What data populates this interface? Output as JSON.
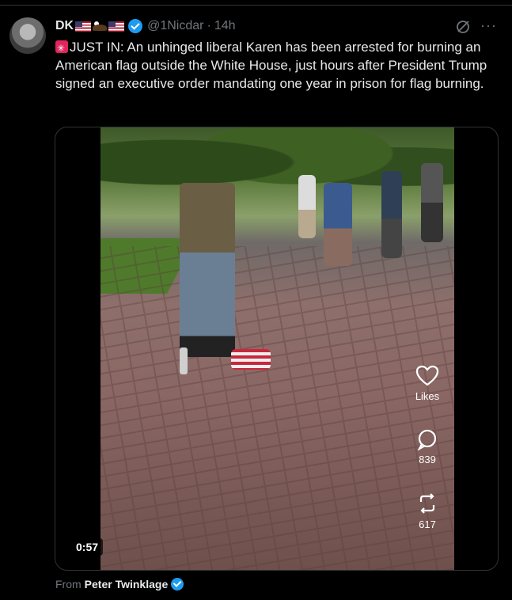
{
  "tweet": {
    "display_name": "DK",
    "handle": "@1Nicdar",
    "separator": "·",
    "time": "14h",
    "text": "JUST IN: An unhinged liberal Karen has been arrested for burning an American flag outside the White House, just hours after President Trump signed an executive order mandating one year in prison for flag burning.",
    "name_emojis": [
      "us-flag",
      "eagle",
      "us-flag"
    ],
    "verified_color": "#1d9bf0"
  },
  "video": {
    "duration": "0:57",
    "likes_label": "Likes",
    "comments_count": "839",
    "reposts_count": "617"
  },
  "attribution": {
    "prefix": "From",
    "source_name": "Peter Twinklage"
  }
}
